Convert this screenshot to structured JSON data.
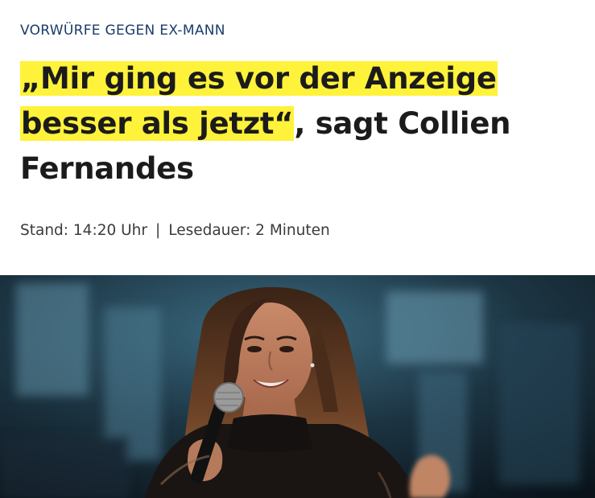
{
  "article": {
    "kicker": "VORWÜRFE GEGEN EX-MANN",
    "headline": {
      "quote": "„Mir ging es vor der Anzeige besser als jetzt“",
      "rest": ", sagt Collien Fernandes"
    },
    "meta": {
      "stand": "Stand: 14:20 Uhr",
      "separator": "|",
      "read_time": "Lesedauer: 2 Minuten"
    },
    "hero_image": {
      "description_icon": "photo-woman-with-microphone"
    }
  },
  "colors": {
    "highlight": "#fff23a",
    "kicker": "#1a3d6b",
    "headline": "#1b1b1b",
    "meta": "#3b3b3b"
  }
}
